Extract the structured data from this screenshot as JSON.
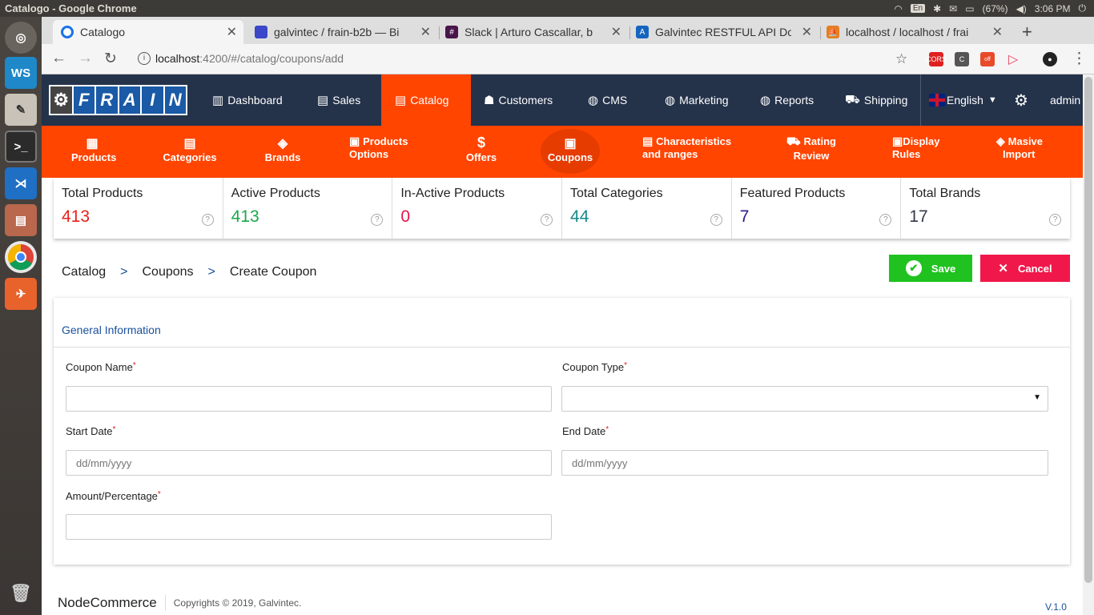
{
  "os": {
    "window_title": "Catalogo - Google Chrome",
    "keyboard": "En",
    "battery": "(67%)",
    "clock": "3:06 PM"
  },
  "browser": {
    "tabs": [
      {
        "label": "Catalogo",
        "color": "#1a73e8"
      },
      {
        "label": "galvintec / frain-b2b — Bi",
        "color": "#3b46c8"
      },
      {
        "label": "Slack | Arturo Cascallar, b",
        "color": "#4a154b"
      },
      {
        "label": "Galvintec RESTFUL API Do",
        "color": "#1565c0"
      },
      {
        "label": "localhost / localhost / frai",
        "color": "#e67e22"
      }
    ],
    "url_host": "localhost",
    "url_rest": ":4200/#/catalog/coupons/add",
    "ext_off": "off"
  },
  "logo": [
    "O",
    "F",
    "R",
    "A",
    "I",
    "N"
  ],
  "topnav": [
    {
      "label": "Dashboard",
      "icon": "dashboard-icon"
    },
    {
      "label": "Sales",
      "icon": "sales-icon"
    },
    {
      "label": "Catalog",
      "icon": "catalog-icon"
    },
    {
      "label": "Customers",
      "icon": "customers-icon"
    },
    {
      "label": "CMS",
      "icon": "cms-icon"
    },
    {
      "label": "Marketing",
      "icon": "marketing-icon"
    },
    {
      "label": "Reports",
      "icon": "reports-icon"
    },
    {
      "label": "Shipping",
      "icon": "shipping-icon"
    }
  ],
  "language": "English",
  "user": "admin",
  "subnav": [
    {
      "line1": "Products",
      "line2": ""
    },
    {
      "line1": "Categories",
      "line2": ""
    },
    {
      "line1": "Brands",
      "line2": ""
    },
    {
      "line1": "Products",
      "line2": "Options"
    },
    {
      "line1": "Offers",
      "line2": ""
    },
    {
      "line1": "Coupons",
      "line2": ""
    },
    {
      "line1": "Characteristics",
      "line2": "and ranges"
    },
    {
      "line1": "Rating",
      "line2": "Review"
    },
    {
      "line1": "Display",
      "line2": "Rules"
    },
    {
      "line1": "Masive",
      "line2": "Import"
    }
  ],
  "stats": [
    {
      "label": "Total Products",
      "value": "413",
      "color": "#e8201a"
    },
    {
      "label": "Active Products",
      "value": "413",
      "color": "#1aa84a"
    },
    {
      "label": "In-Active Products",
      "value": "0",
      "color": "#e8134a"
    },
    {
      "label": "Total Categories",
      "value": "44",
      "color": "#168a8a"
    },
    {
      "label": "Featured Products",
      "value": "7",
      "color": "#2a1a8a"
    },
    {
      "label": "Total Brands",
      "value": "17",
      "color": "#333a4a"
    }
  ],
  "breadcrumb": [
    "Catalog",
    ">",
    "Coupons",
    ">",
    "Create Coupon"
  ],
  "actions": {
    "save": "Save",
    "cancel": "Cancel"
  },
  "form": {
    "section_title": "General Information",
    "coupon_name": {
      "label": "Coupon Name",
      "value": ""
    },
    "coupon_type": {
      "label": "Coupon Type",
      "value": ""
    },
    "start_date": {
      "label": "Start Date",
      "placeholder": "dd/mm/yyyy"
    },
    "end_date": {
      "label": "End Date",
      "placeholder": "dd/mm/yyyy"
    },
    "amount": {
      "label": "Amount/Percentage",
      "value": ""
    },
    "required_mark": "*"
  },
  "footer": {
    "brand": "NodeCommerce",
    "copyright": "Copyrights © 2019, Galvintec.",
    "version": "V.1.0"
  }
}
